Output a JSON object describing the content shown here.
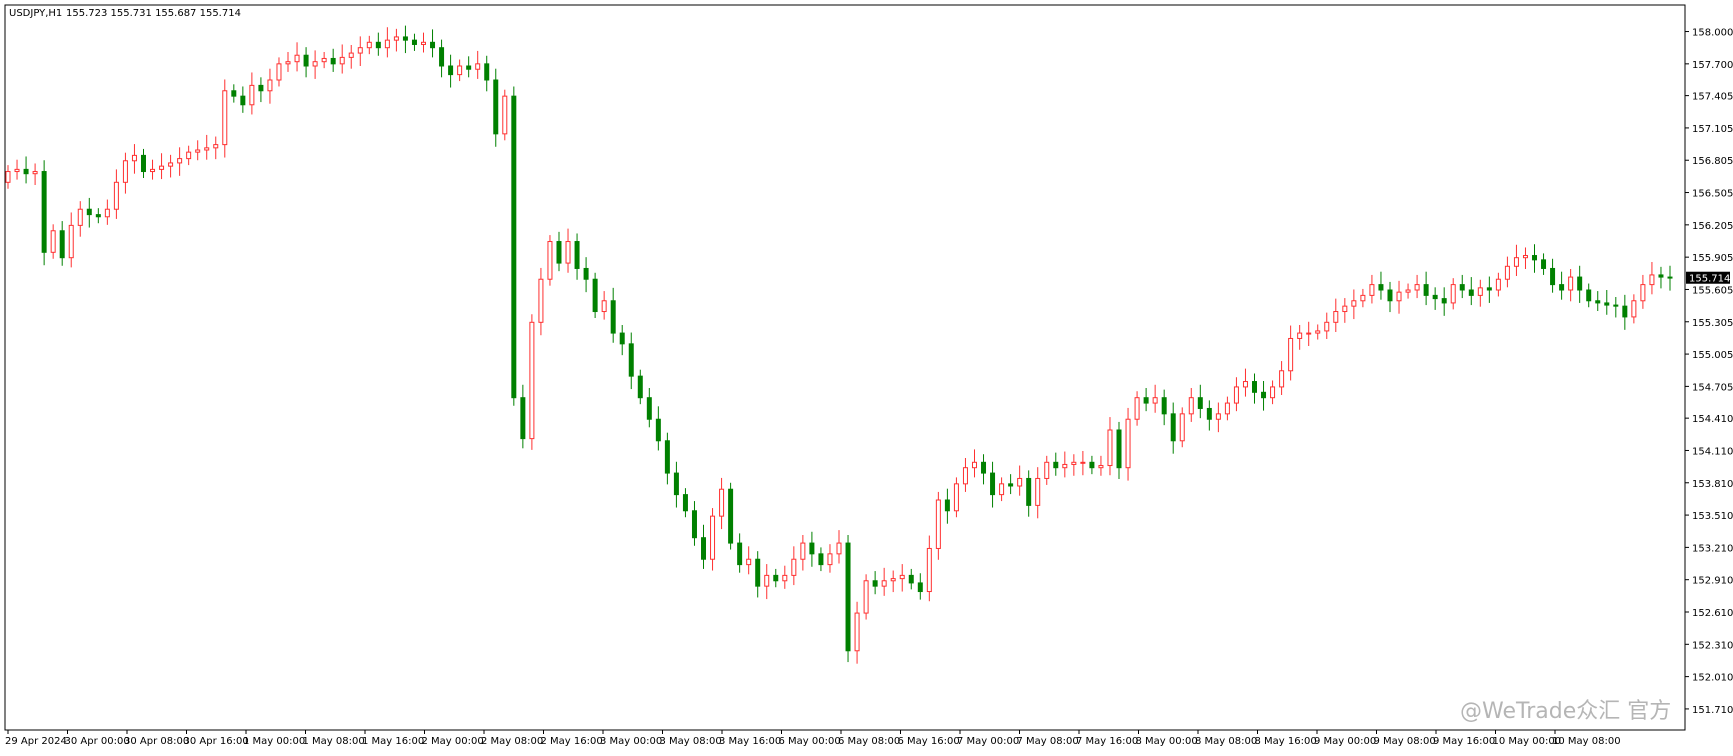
{
  "header": {
    "symbol_tf": "USDJPY,H1",
    "ohlc": "155.723 155.731 155.687 155.714"
  },
  "watermark": {
    "text": "@WeTrade众汇 官方"
  },
  "colors": {
    "bull": "#ff3030",
    "bear": "#008000",
    "axis": "#000000",
    "price_label_bg": "#000000",
    "price_label_text": "#ffffff"
  },
  "chart_data": {
    "type": "candlestick",
    "ylim": [
      151.7,
      158.2
    ],
    "y_ticks": [
      "158.000",
      "157.700",
      "157.405",
      "157.105",
      "156.805",
      "156.505",
      "156.205",
      "155.905",
      "155.605",
      "155.305",
      "155.005",
      "154.705",
      "154.410",
      "154.110",
      "153.810",
      "153.510",
      "153.210",
      "152.910",
      "152.610",
      "152.310",
      "152.010",
      "151.710"
    ],
    "x_ticks": [
      "29 Apr 2024",
      "30 Apr 00:00",
      "30 Apr 08:00",
      "30 Apr 16:00",
      "1 May 00:00",
      "1 May 08:00",
      "1 May 16:00",
      "2 May 00:00",
      "2 May 08:00",
      "2 May 16:00",
      "3 May 00:00",
      "3 May 08:00",
      "3 May 16:00",
      "6 May 00:00",
      "6 May 08:00",
      "6 May 16:00",
      "7 May 00:00",
      "7 May 08:00",
      "7 May 16:00",
      "8 May 00:00",
      "8 May 08:00",
      "8 May 16:00",
      "9 May 00:00",
      "9 May 08:00",
      "9 May 16:00",
      "10 May 00:00",
      "10 May 08:00"
    ],
    "last_price": "155.714",
    "closes": [
      156.7,
      156.72,
      156.68,
      156.7,
      155.95,
      156.15,
      155.9,
      156.2,
      156.35,
      156.3,
      156.28,
      156.35,
      156.6,
      156.8,
      156.85,
      156.7,
      156.72,
      156.75,
      156.78,
      156.82,
      156.88,
      156.9,
      156.92,
      156.95,
      157.45,
      157.4,
      157.32,
      157.5,
      157.45,
      157.55,
      157.7,
      157.72,
      157.78,
      157.68,
      157.72,
      157.75,
      157.7,
      157.76,
      157.8,
      157.85,
      157.9,
      157.85,
      157.92,
      157.95,
      157.92,
      157.88,
      157.9,
      157.85,
      157.68,
      157.6,
      157.68,
      157.65,
      157.7,
      157.55,
      157.05,
      157.4,
      154.6,
      154.22,
      155.3,
      155.7,
      156.05,
      155.85,
      156.05,
      155.8,
      155.7,
      155.4,
      155.5,
      155.2,
      155.1,
      154.8,
      154.6,
      154.4,
      154.2,
      153.9,
      153.7,
      153.55,
      153.3,
      153.1,
      153.5,
      153.75,
      153.25,
      153.05,
      153.1,
      152.85,
      152.95,
      152.9,
      152.95,
      153.1,
      153.25,
      153.15,
      153.05,
      153.15,
      153.25,
      152.25,
      152.6,
      152.9,
      152.85,
      152.9,
      152.92,
      152.95,
      152.88,
      152.8,
      153.2,
      153.65,
      153.55,
      153.8,
      153.95,
      154.0,
      153.9,
      153.7,
      153.8,
      153.78,
      153.85,
      153.6,
      153.85,
      154.0,
      153.95,
      153.98,
      154.0,
      154.0,
      153.95,
      153.97,
      154.3,
      153.95,
      154.4,
      154.6,
      154.55,
      154.6,
      154.45,
      154.2,
      154.45,
      154.6,
      154.5,
      154.4,
      154.45,
      154.55,
      154.7,
      154.75,
      154.65,
      154.6,
      154.7,
      154.85,
      155.15,
      155.2,
      155.2,
      155.22,
      155.3,
      155.4,
      155.45,
      155.5,
      155.55,
      155.65,
      155.6,
      155.5,
      155.58,
      155.6,
      155.65,
      155.55,
      155.52,
      155.48,
      155.65,
      155.6,
      155.55,
      155.62,
      155.6,
      155.7,
      155.82,
      155.9,
      155.92,
      155.88,
      155.8,
      155.65,
      155.6,
      155.72,
      155.6,
      155.5,
      155.48,
      155.46,
      155.45,
      155.35,
      155.5,
      155.65,
      155.74,
      155.72,
      155.714
    ]
  }
}
